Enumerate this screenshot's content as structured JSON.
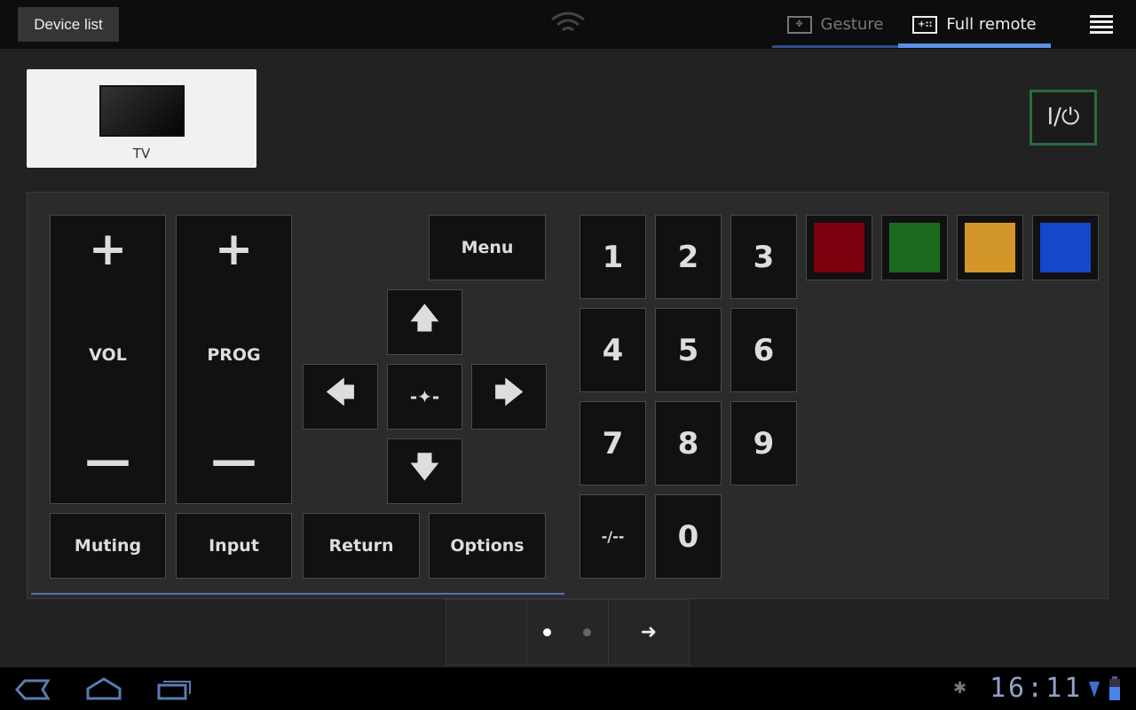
{
  "topbar": {
    "device_list": "Device list",
    "wifi_icon": "wifi-icon",
    "tabs": [
      {
        "label": "Gesture",
        "icon": "gesture-icon",
        "active": false
      },
      {
        "label": "Full remote",
        "icon": "full-remote-icon",
        "active": true
      }
    ],
    "menu_icon": "menu-icon",
    "accent": "#5b8fe8"
  },
  "device": {
    "label": "TV"
  },
  "power": {
    "label": "I/⏻"
  },
  "remote": {
    "vol": {
      "plus": "+",
      "label": "VOL",
      "minus": "—"
    },
    "prog": {
      "plus": "+",
      "label": "PROG",
      "minus": "—"
    },
    "menu": "Menu",
    "dpad": {
      "up": "🡅",
      "left": "🡄",
      "right": "🡆",
      "down": "🡇",
      "center": "-✦-"
    },
    "bottom": [
      "Muting",
      "Input",
      "Return",
      "Options"
    ],
    "numbers": [
      "1",
      "2",
      "3",
      "4",
      "5",
      "6",
      "7",
      "8",
      "9",
      "-/--",
      "0"
    ],
    "colors": [
      "#7d0010",
      "#1a6b1f",
      "#d39628",
      "#1647c8"
    ]
  },
  "pager": {
    "arrow": "➜",
    "active_page": 1,
    "pages": 2
  },
  "statusbar": {
    "time": "16:11",
    "debug_icon": "bug-icon",
    "wifi_icon": "wifi-signal-icon",
    "battery_icon": "battery-icon"
  }
}
